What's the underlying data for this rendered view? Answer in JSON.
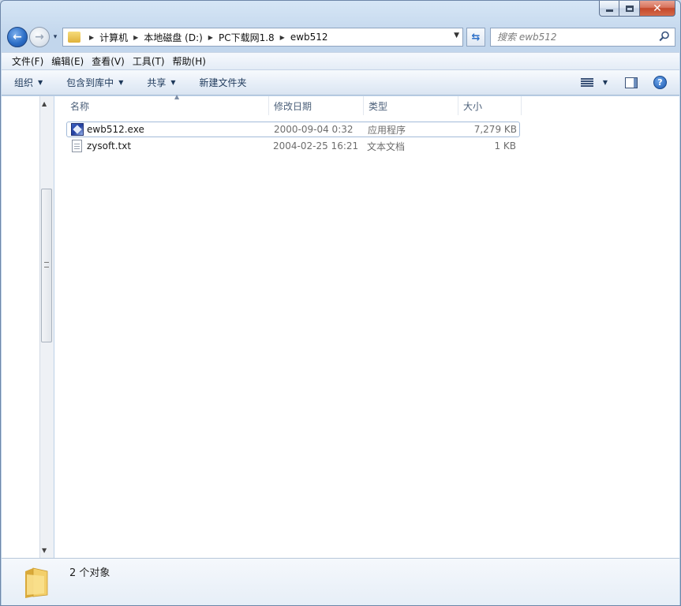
{
  "window": {
    "caption": {
      "minimize": "—",
      "maximize": "",
      "close": "✕"
    }
  },
  "navigation": {
    "back_glyph": "←",
    "forward_glyph": "→",
    "recent_glyph": "▾",
    "breadcrumbs": [
      "计算机",
      "本地磁盘 (D:)",
      "PC下载网1.8",
      "ewb512"
    ],
    "breadcrumb_separator": "▶",
    "dropdown_glyph": "▼",
    "refresh_glyph": "⇆",
    "search_placeholder": "搜索 ewb512"
  },
  "menubar": [
    "文件(F)",
    "编辑(E)",
    "查看(V)",
    "工具(T)",
    "帮助(H)"
  ],
  "commandbar": {
    "organize": "组织",
    "include_in_library": "包含到库中",
    "share": "共享",
    "new_folder": "新建文件夹",
    "caret": "▼",
    "help": "?"
  },
  "columns": {
    "name": "名称",
    "modified": "修改日期",
    "type": "类型",
    "size": "大小",
    "sort_arrow": "▲"
  },
  "files": [
    {
      "name": "ewb512.exe",
      "modified": "2000-09-04 0:32",
      "type": "应用程序",
      "size": "7,279 KB",
      "icon": "exe-icon",
      "selected": true
    },
    {
      "name": "zysoft.txt",
      "modified": "2004-02-25 16:21",
      "type": "文本文档",
      "size": "1 KB",
      "icon": "text-file-icon",
      "selected": false
    }
  ],
  "navpane_scroll": {
    "up": "▲",
    "down": "▼"
  },
  "details": {
    "count": "2 个对象"
  },
  "colors": {
    "accent": "#2d6fc7",
    "selection_border": "#a3bbd9",
    "close_red": "#c4482b"
  }
}
